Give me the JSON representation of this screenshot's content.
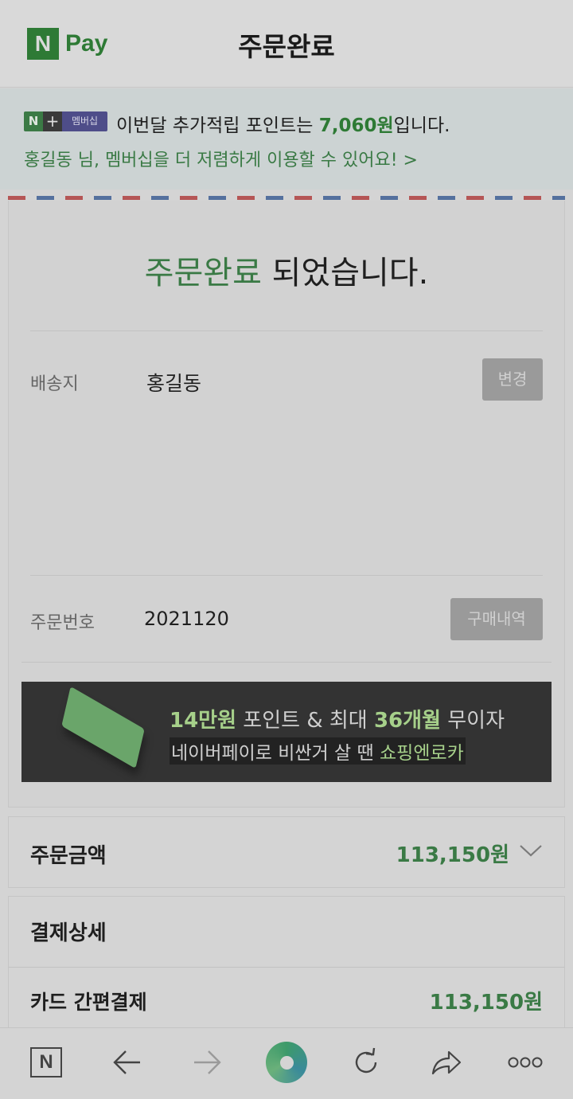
{
  "header": {
    "logo_letter": "N",
    "logo_text": "Pay",
    "title": "주문완료"
  },
  "membership": {
    "badge": {
      "n": "N",
      "plus": "+",
      "label": "멤버십"
    },
    "line_prefix": "이번달 추가적립 포인트는 ",
    "points": "7,060원",
    "line_suffix": "입니다.",
    "link_text": "홍길동 님, 멤버십을 더 저렴하게 이용할 수 있어요! >"
  },
  "confirmation": {
    "highlight": "주문완료",
    "rest": " 되었습니다."
  },
  "shipping": {
    "label": "배송지",
    "value": "홍길동",
    "button": "변경"
  },
  "order": {
    "label": "주문번호",
    "value": "2021120",
    "button": "구매내역"
  },
  "banner": {
    "l1_a": "14만원",
    "l1_b": " 포인트 & 최대 ",
    "l1_c": "36개월",
    "l1_d": " 무이자",
    "l2_a": "네이버페이로 비싼거 살 땐 ",
    "l2_b": "쇼핑엔로카"
  },
  "order_amount": {
    "label": "주문금액",
    "value": "113,150원"
  },
  "payment": {
    "title": "결제상세",
    "method": "카드 간편결제",
    "amount": "113,150원"
  },
  "bottom_nav": {
    "home_letter": "N"
  }
}
